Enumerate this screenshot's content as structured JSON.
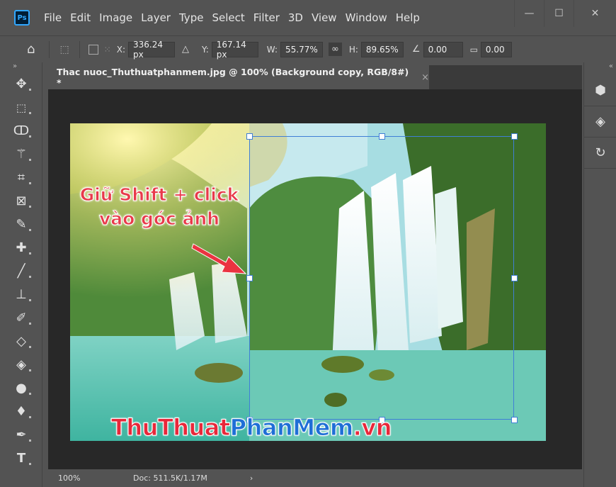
{
  "app": {
    "logo": "Ps"
  },
  "menu": [
    "File",
    "Edit",
    "Image",
    "Layer",
    "Type",
    "Select",
    "Filter",
    "3D",
    "View",
    "Window",
    "Help"
  ],
  "window_controls": {
    "minimize": "—",
    "restore": "☐",
    "close": "✕"
  },
  "options": {
    "x_label": "X:",
    "x_value": "336.24 px",
    "y_label": "Y:",
    "y_value": "167.14 px",
    "w_label": "W:",
    "w_value": "55.77%",
    "h_label": "H:",
    "h_value": "89.65%",
    "angle_value": "0.00",
    "skew_value": "0.00"
  },
  "document": {
    "tab_title": "Thac nuoc_Thuthuatphanmem.jpg @ 100% (Background copy, RGB/8#) *",
    "close": "×"
  },
  "annotation": {
    "line1": "Giữ Shift + click",
    "line2": "vào góc ảnh"
  },
  "watermark": {
    "part1": "ThuThuat",
    "part2": "PhanMem",
    "part3": ".vn"
  },
  "status": {
    "zoom": "100%",
    "doc": "Doc: 511.5K/1.17M",
    "arrow": "›"
  },
  "tools": [
    "move-tool",
    "marquee-tool",
    "lasso-tool",
    "magic-wand-tool",
    "crop-tool",
    "frame-tool",
    "eyedropper-tool",
    "healing-tool",
    "brush-tool",
    "stamp-tool",
    "history-brush-tool",
    "eraser-tool",
    "paint-bucket-tool",
    "blur-tool",
    "dodge-tool",
    "pen-tool",
    "type-tool"
  ],
  "right_panel": [
    "3d-icon",
    "layers-icon",
    "history-icon"
  ]
}
